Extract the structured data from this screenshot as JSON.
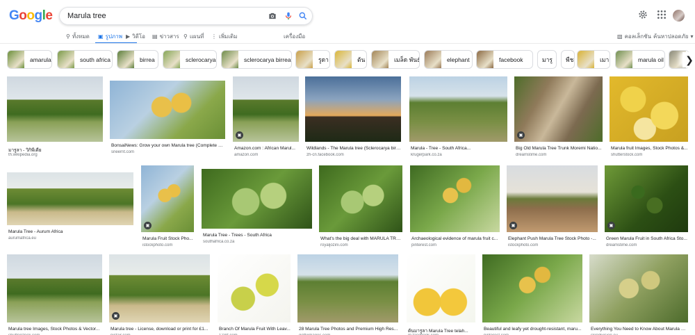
{
  "header": {
    "logo_letters": [
      {
        "ch": "G",
        "color": "#4285F4"
      },
      {
        "ch": "o",
        "color": "#EA4335"
      },
      {
        "ch": "o",
        "color": "#FBBC05"
      },
      {
        "ch": "g",
        "color": "#4285F4"
      },
      {
        "ch": "l",
        "color": "#34A853"
      },
      {
        "ch": "e",
        "color": "#EA4335"
      }
    ],
    "search_query": "Marula tree",
    "icons": [
      "camera-icon",
      "microphone-icon",
      "search-icon",
      "settings-icon",
      "apps-grid-icon"
    ]
  },
  "tabs": {
    "all": "ทั้งหมด",
    "images": "รูปภาพ",
    "videos": "วิดีโอ",
    "news": "ข่าวสาร",
    "maps": "แผนที่",
    "more": "เพิ่มเติม",
    "tools": "เครื่องมือ",
    "collections": "คอลเล็กชัน",
    "safesearch": "ค้นหาปลอดภัย"
  },
  "colors": {
    "accent": "#1a73e8",
    "text": "#202124",
    "muted": "#70757a"
  },
  "chips": [
    {
      "label": "amarula",
      "thumb": "#6b8f3a"
    },
    {
      "label": "south africa",
      "thumb": "#7a9a48"
    },
    {
      "label": "birrea",
      "thumb": "#5c7e3b"
    },
    {
      "label": "sclerocarya",
      "thumb": "#86a657"
    },
    {
      "label": "sclerocarya birrea",
      "thumb": "#6e8c4a"
    },
    {
      "label": "รูดา",
      "thumb": "#c9a04a"
    },
    {
      "label": "ต้น",
      "thumb": "#d9b63a"
    },
    {
      "label": "เมล็ด พันธุ์",
      "thumb": "#a38658"
    },
    {
      "label": "elephant",
      "thumb": "#9a7a58"
    },
    {
      "label": "facebook",
      "thumb": "#8b6a44"
    },
    {
      "label": "มารู",
      "thumb": ""
    },
    {
      "label": "พืช",
      "thumb": ""
    },
    {
      "label": "เมา",
      "thumb": "#d8b236"
    },
    {
      "label": "marula oil",
      "thumb": "#708f50"
    },
    {
      "label": "",
      "thumb": "#8a8a7a"
    }
  ],
  "results": [
    {
      "caption": "มารูลา - วิกิพีเดีย",
      "source": "th.wikipedia.org",
      "badge": false
    },
    {
      "caption": "BonsaiNews: Grow your own Marula tree (Complete G...",
      "source": "sneernt.com",
      "badge": false
    },
    {
      "caption": "Amazon.com : African Marul...",
      "source": "amazon.com",
      "badge": true
    },
    {
      "caption": "Wildlands - The Marula tree (Sclerocarya birr...",
      "source": "zh-cn.facebook.com",
      "badge": false
    },
    {
      "caption": "Marula - Tree - South Africa...",
      "source": "krugerpark.co.za",
      "badge": false
    },
    {
      "caption": "Big Old Marula Tree Trunk Moremi Natio...",
      "source": "dreamstime.com",
      "badge": true
    },
    {
      "caption": "Marula fruit Images, Stock Photos &...",
      "source": "shutterstock.com",
      "badge": false
    },
    {
      "caption": "Marula Tree - Aurum Africa",
      "source": "aurumafrica.eu",
      "badge": false
    },
    {
      "caption": "Marula Fruit Stock Pho...",
      "source": "istockphoto.com",
      "badge": true
    },
    {
      "caption": "Marula Tree - Trees - South Africa",
      "source": "southafrica.co.za",
      "badge": false
    },
    {
      "caption": "What's the big deal with MARULA TRE...",
      "source": "royaljozini.com",
      "badge": false
    },
    {
      "caption": "Archaeological evidence of marula fruit c...",
      "source": "pinterest.com",
      "badge": false
    },
    {
      "caption": "Elephant Push Marula Tree Stock Photo -...",
      "source": "istockphoto.com",
      "badge": true
    },
    {
      "caption": "Green Marula Fruit in South Africa Sto...",
      "source": "dreamstime.com",
      "badge": true
    },
    {
      "caption": "Marula tree Images, Stock Photos & Vector...",
      "source": "shutterstock.com",
      "badge": false
    },
    {
      "caption": "Marula tree - License, download or print for £1...",
      "source": "picfair.com",
      "badge": true
    },
    {
      "caption": "Branch Of Marula Fruit With Leav...",
      "source": "123rf.com",
      "badge": false
    },
    {
      "caption": "28 Marula Tree Photos and Premium High Res...",
      "source": "gettyimages.com",
      "badge": false
    },
    {
      "caption": "ต้นมารูลา Marula Tree telah...",
      "source": "m.facebook.com",
      "badge": false
    },
    {
      "caption": "Beautiful and leafy yet drought-resistant, maru...",
      "source": "pinterest.com",
      "badge": false
    },
    {
      "caption": "Everything You Need to Know About Marula O...",
      "source": "skindivision.eu",
      "badge": false
    }
  ]
}
